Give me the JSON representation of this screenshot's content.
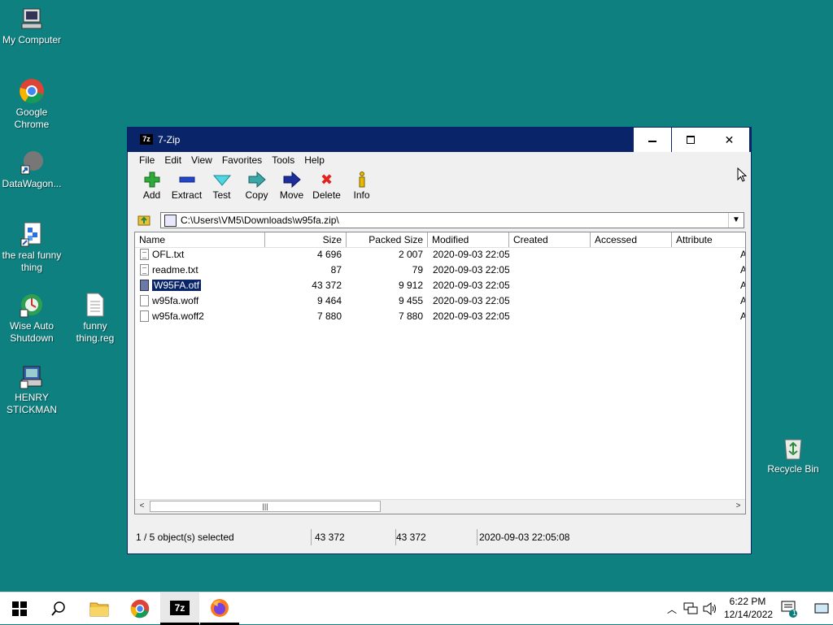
{
  "desktop": {
    "icons": [
      {
        "label": "My Computer"
      },
      {
        "label": "Google\nChrome"
      },
      {
        "label": "DataWagon..."
      },
      {
        "label": "the real funny\nthing"
      },
      {
        "label": "Wise Auto\nShutdown"
      },
      {
        "label": "funny\nthing.reg"
      },
      {
        "label": "HENRY\nSTICKMAN"
      },
      {
        "label": "Recycle Bin"
      }
    ]
  },
  "window": {
    "app_icon_text": "7z",
    "title": "7-Zip",
    "menu": [
      "File",
      "Edit",
      "View",
      "Favorites",
      "Tools",
      "Help"
    ],
    "toolbar": [
      "Add",
      "Extract",
      "Test",
      "Copy",
      "Move",
      "Delete",
      "Info"
    ],
    "address": "C:\\Users\\VM5\\Downloads\\w95fa.zip\\",
    "columns": [
      "Name",
      "Size",
      "Packed Size",
      "Modified",
      "Created",
      "Accessed",
      "Attribute"
    ],
    "files": [
      {
        "name": "OFL.txt",
        "size": "4 696",
        "packed": "2 007",
        "modified": "2020-09-03 22:05",
        "attr": "A",
        "icon": "text-file-icon"
      },
      {
        "name": "readme.txt",
        "size": "87",
        "packed": "79",
        "modified": "2020-09-03 22:05",
        "attr": "A",
        "icon": "text-file-icon"
      },
      {
        "name": "W95FA.otf",
        "size": "43 372",
        "packed": "9 912",
        "modified": "2020-09-03 22:05",
        "attr": "A",
        "icon": "font-file-icon",
        "selected": true
      },
      {
        "name": "w95fa.woff",
        "size": "9 464",
        "packed": "9 455",
        "modified": "2020-09-03 22:05",
        "attr": "A",
        "icon": "file-icon"
      },
      {
        "name": "w95fa.woff2",
        "size": "7 880",
        "packed": "7 880",
        "modified": "2020-09-03 22:05",
        "attr": "A",
        "icon": "file-icon"
      }
    ],
    "status": {
      "selection": "1 / 5 object(s) selected",
      "size": "43 372",
      "packed": "43 372",
      "modified": "2020-09-03 22:05:08"
    }
  },
  "taskbar": {
    "sevenzip_label": "7z",
    "clock_time": "6:22 PM",
    "clock_date": "12/14/2022",
    "notification_count": "1"
  },
  "colors": {
    "desktop": "#0f8080",
    "titlebar": "#0a246a",
    "selection": "#0a246a"
  }
}
